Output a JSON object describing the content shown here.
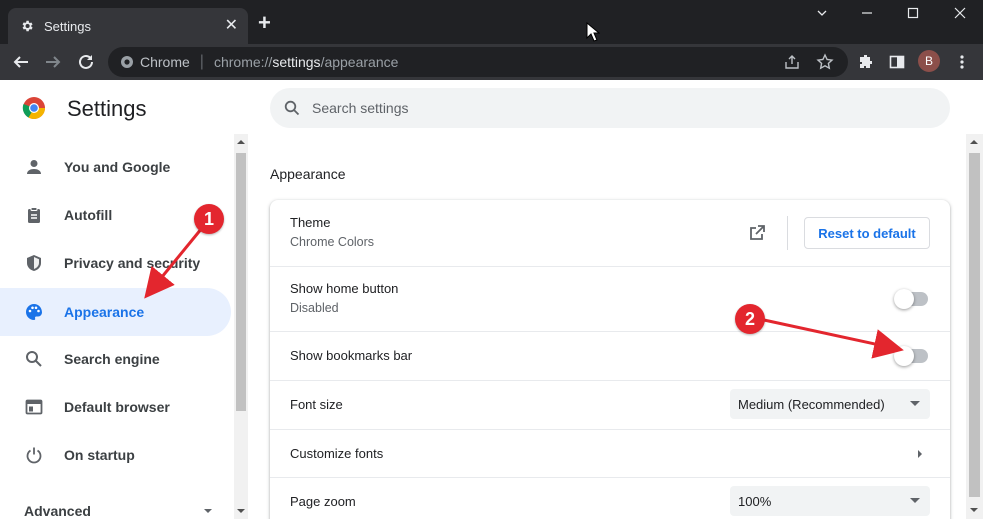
{
  "tab": {
    "title": "Settings",
    "close": "✕",
    "new_tab": "+"
  },
  "window_controls": {
    "minimize": "—",
    "maximize": "☐",
    "close": "✕",
    "chevron": "⌄"
  },
  "omnibox": {
    "site_chip": "Chrome",
    "url_scheme": "chrome://",
    "url_host": "settings",
    "url_path": "/appearance"
  },
  "profile": {
    "initial": "B"
  },
  "header": {
    "title": "Settings",
    "search_placeholder": "Search settings"
  },
  "sidebar": {
    "items": [
      {
        "label": "You and Google",
        "icon": "person-icon"
      },
      {
        "label": "Autofill",
        "icon": "clipboard-icon"
      },
      {
        "label": "Privacy and security",
        "icon": "shield-icon"
      },
      {
        "label": "Appearance",
        "icon": "palette-icon",
        "active": true
      },
      {
        "label": "Search engine",
        "icon": "search-icon"
      },
      {
        "label": "Default browser",
        "icon": "browser-icon"
      },
      {
        "label": "On startup",
        "icon": "power-icon"
      }
    ],
    "advanced": "Advanced"
  },
  "main": {
    "section_title": "Appearance",
    "theme": {
      "label": "Theme",
      "value": "Chrome Colors",
      "reset": "Reset to default"
    },
    "home_button": {
      "label": "Show home button",
      "value": "Disabled",
      "enabled": false
    },
    "bookmarks_bar": {
      "label": "Show bookmarks bar",
      "enabled": false
    },
    "font_size": {
      "label": "Font size",
      "selected": "Medium (Recommended)"
    },
    "customize_fonts": {
      "label": "Customize fonts"
    },
    "page_zoom": {
      "label": "Page zoom",
      "selected": "100%"
    }
  },
  "annotations": {
    "one": "1",
    "two": "2"
  },
  "colors": {
    "accent": "#1a73e8",
    "annotation": "#e3262e",
    "active_nav_bg": "#e8f0fe"
  }
}
